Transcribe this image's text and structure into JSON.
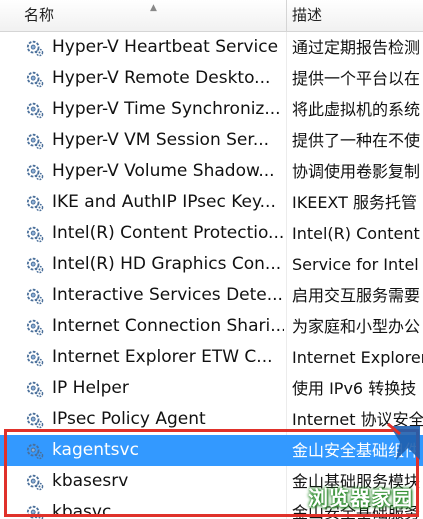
{
  "header": {
    "name": "名称",
    "description": "描述"
  },
  "services": [
    {
      "name": "Hyper-V Heartbeat Service",
      "description": "通过定期报告检测"
    },
    {
      "name": "Hyper-V Remote Deskto...",
      "description": "提供一个平台以在"
    },
    {
      "name": "Hyper-V Time Synchroniz...",
      "description": "将此虚拟机的系统"
    },
    {
      "name": "Hyper-V VM Session Ser...",
      "description": "提供了一种在不使"
    },
    {
      "name": "Hyper-V Volume Shadow...",
      "description": "协调使用卷影复制"
    },
    {
      "name": "IKE and AuthIP IPsec Key...",
      "description": "IKEEXT 服务托管"
    },
    {
      "name": "Intel(R) Content Protectio...",
      "description": "Intel(R) Content"
    },
    {
      "name": "Intel(R) HD Graphics Con...",
      "description": "Service for Intel"
    },
    {
      "name": "Interactive Services Dete...",
      "description": "启用交互服务需要"
    },
    {
      "name": "Internet Connection Shari...",
      "description": "为家庭和小型办公"
    },
    {
      "name": "Internet Explorer ETW C...",
      "description": "Internet Explorer"
    },
    {
      "name": "IP Helper",
      "description": "使用 IPv6 转换技"
    },
    {
      "name": "IPsec Policy Agent",
      "description": "Internet 协议安全"
    },
    {
      "name": "kagentsvc",
      "description": "金山安全基础组件"
    },
    {
      "name": "kbasesrv",
      "description": "金山基础服务模块"
    },
    {
      "name": "kbasvc",
      "description": "金山安全基础服务"
    }
  ],
  "selected_service": "kagentsvc",
  "watermark": "浏览器家园",
  "colors": {
    "selection": "#3399ff",
    "highlight_box": "#e0312a",
    "watermark_glow": "#2d8f2d"
  }
}
